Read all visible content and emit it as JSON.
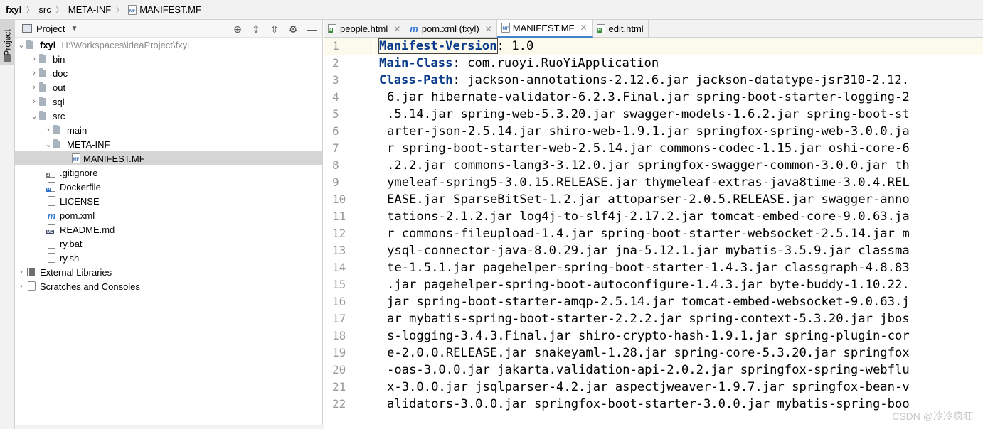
{
  "breadcrumb": {
    "project": "fxyl",
    "items": [
      "src",
      "META-INF",
      "MANIFEST.MF"
    ]
  },
  "left_strip": {
    "label": "Project"
  },
  "project_panel": {
    "title": "Project",
    "tree": [
      {
        "label": "fxyl",
        "hint": "H:\\Workspaces\\ideaProject\\fxyl"
      },
      {
        "label": "bin"
      },
      {
        "label": "doc"
      },
      {
        "label": "out"
      },
      {
        "label": "sql"
      },
      {
        "label": "src"
      },
      {
        "label": "main"
      },
      {
        "label": "META-INF"
      },
      {
        "label": "MANIFEST.MF"
      },
      {
        "label": ".gitignore"
      },
      {
        "label": "Dockerfile"
      },
      {
        "label": "LICENSE"
      },
      {
        "label": "pom.xml"
      },
      {
        "label": "README.md"
      },
      {
        "label": "ry.bat"
      },
      {
        "label": "ry.sh"
      },
      {
        "label": "External Libraries"
      },
      {
        "label": "Scratches and Consoles"
      }
    ]
  },
  "tabs": [
    {
      "label": "people.html"
    },
    {
      "label": "pom.xml (fxyl)"
    },
    {
      "label": "MANIFEST.MF"
    },
    {
      "label": "edit.html"
    }
  ],
  "editor": {
    "line_numbers": [
      "1",
      "2",
      "3",
      "4",
      "5",
      "6",
      "7",
      "8",
      "9",
      "10",
      "11",
      "12",
      "13",
      "14",
      "15",
      "16",
      "17",
      "18",
      "19",
      "20",
      "21",
      "22"
    ],
    "line1": {
      "key": "Manifest-Version",
      "rest": ": 1.0"
    },
    "line2": {
      "key": "Main-Class",
      "rest": ": com.ruoyi.RuoYiApplication"
    },
    "line3": {
      "key": "Class-Path",
      "rest": ": jackson-annotations-2.12.6.jar jackson-datatype-jsr310-2.12."
    },
    "continuation": [
      "6.jar hibernate-validator-6.2.3.Final.jar spring-boot-starter-logging-2",
      ".5.14.jar spring-web-5.3.20.jar swagger-models-1.6.2.jar spring-boot-st",
      "arter-json-2.5.14.jar shiro-web-1.9.1.jar springfox-spring-web-3.0.0.ja",
      "r spring-boot-starter-web-2.5.14.jar commons-codec-1.15.jar oshi-core-6",
      ".2.2.jar commons-lang3-3.12.0.jar springfox-swagger-common-3.0.0.jar th",
      "ymeleaf-spring5-3.0.15.RELEASE.jar thymeleaf-extras-java8time-3.0.4.REL",
      "EASE.jar SparseBitSet-1.2.jar attoparser-2.0.5.RELEASE.jar swagger-anno",
      "tations-2.1.2.jar log4j-to-slf4j-2.17.2.jar tomcat-embed-core-9.0.63.ja",
      "r commons-fileupload-1.4.jar spring-boot-starter-websocket-2.5.14.jar m",
      "ysql-connector-java-8.0.29.jar jna-5.12.1.jar mybatis-3.5.9.jar classma",
      "te-1.5.1.jar pagehelper-spring-boot-starter-1.4.3.jar classgraph-4.8.83",
      ".jar pagehelper-spring-boot-autoconfigure-1.4.3.jar byte-buddy-1.10.22.",
      "jar spring-boot-starter-amqp-2.5.14.jar tomcat-embed-websocket-9.0.63.j",
      "ar mybatis-spring-boot-starter-2.2.2.jar spring-context-5.3.20.jar jbos",
      "s-logging-3.4.3.Final.jar shiro-crypto-hash-1.9.1.jar spring-plugin-cor",
      "e-2.0.0.RELEASE.jar snakeyaml-1.28.jar spring-core-5.3.20.jar springfox",
      "-oas-3.0.0.jar jakarta.validation-api-2.0.2.jar springfox-spring-webflu",
      "x-3.0.0.jar jsqlparser-4.2.jar aspectjweaver-1.9.7.jar springfox-bean-v",
      "alidators-3.0.0.jar springfox-boot-starter-3.0.0.jar mybatis-spring-boo"
    ]
  },
  "watermark": "CSDN @冷冷疯狂",
  "colors": {
    "key": "#0b3c8c",
    "active_tab_underline": "#4083c9",
    "selection": "#d5d5d5"
  }
}
